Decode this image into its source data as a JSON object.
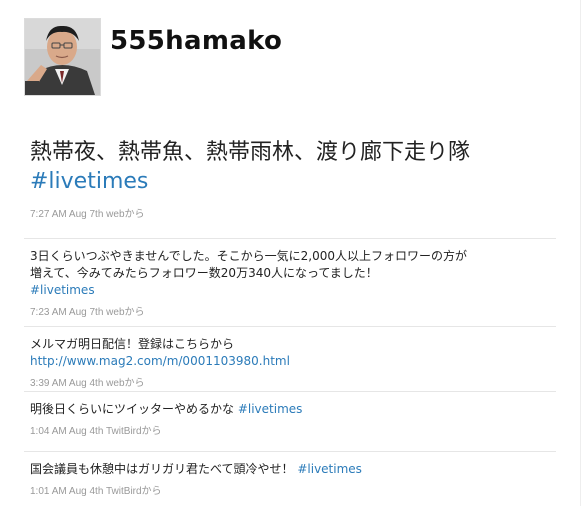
{
  "profile": {
    "username": "555hamako",
    "avatar_icon": "user-avatar-photo"
  },
  "featured_tweet": {
    "text": "熱帯夜、熱帯魚、熱帯雨林、渡り廊下走り隊 ",
    "hashtag": "#livetimes",
    "time": "7:27 AM Aug 7th",
    "via": "webから"
  },
  "tweets": [
    {
      "text": "3日くらいつぶやきませんでした。そこから一気に2,000人以上フォロワーの方が増えて、今みてみたらフォロワー数20万340人になってました！",
      "hashtag": "#livetimes",
      "time": "7:23 AM Aug 7th",
      "via": "webから"
    },
    {
      "text": "メルマガ明日配信！登録はこちらから",
      "link": "http://www.mag2.com/m/0001103980.html",
      "time": "3:39 AM Aug 4th",
      "via": "webから"
    },
    {
      "text": "明後日くらいにツイッターやめるかな ",
      "hashtag": "#livetimes",
      "time": "1:04 AM Aug 4th",
      "via": "TwitBirdから"
    },
    {
      "text": "国会議員も休憩中はガリガリ君たべて頭冷やせ！ ",
      "hashtag": "#livetimes",
      "time": "1:01 AM Aug 4th",
      "via": "TwitBirdから"
    }
  ],
  "colors": {
    "link": "#2b7bb9",
    "meta": "#999999",
    "text": "#222222",
    "divider": "#e6e6e6"
  }
}
